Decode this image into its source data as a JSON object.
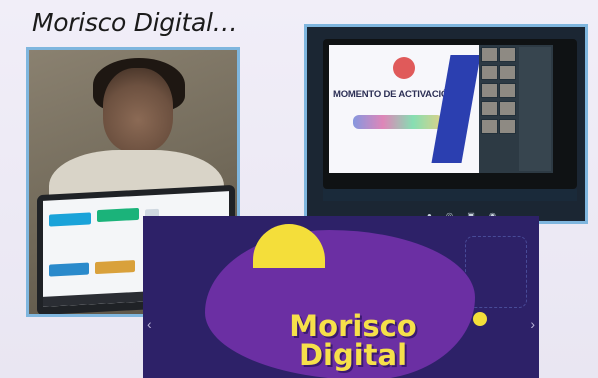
{
  "header": {
    "title": "Morisco Digital…"
  },
  "right_screen": {
    "slide_heading": "MOMENTO DE ACTIVACIÓN…"
  },
  "banner": {
    "brand_line1": "Morisco",
    "brand_line2": "Digital"
  },
  "colors": {
    "frame_border": "#7fb6de",
    "banner_bg": "#2d2168",
    "blob": "#6b2fa3",
    "accent_yellow": "#f4de3a"
  },
  "icons": {
    "prev": "chevron-left-icon",
    "next": "chevron-right-icon"
  }
}
